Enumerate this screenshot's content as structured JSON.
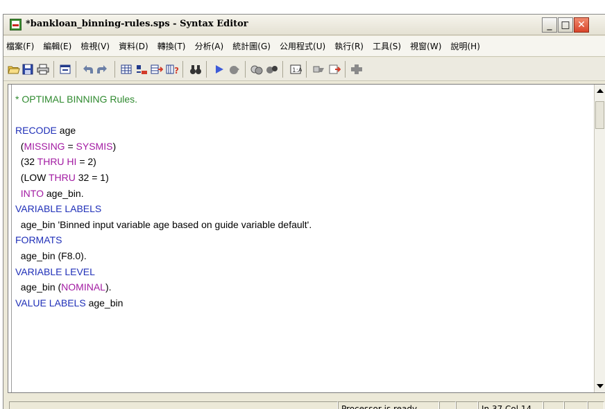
{
  "window": {
    "title": "*bankloan_binning-rules.sps - Syntax Editor",
    "minimize_symbol": "_",
    "maximize_symbol": "□",
    "close_symbol": "✕"
  },
  "menu": {
    "items": [
      {
        "label": "檔案(F)"
      },
      {
        "label": "編輯(E)"
      },
      {
        "label": "檢視(V)"
      },
      {
        "label": "資料(D)"
      },
      {
        "label": "轉換(T)"
      },
      {
        "label": "分析(A)"
      },
      {
        "label": "統計圖(G)"
      },
      {
        "label": "公用程式(U)"
      },
      {
        "label": "執行(R)"
      },
      {
        "label": "工具(S)"
      },
      {
        "label": "視窗(W)"
      },
      {
        "label": "說明(H)"
      }
    ]
  },
  "toolbar": {
    "icons": [
      "open-folder-icon",
      "save-icon",
      "print-icon",
      "dialog-recall-icon",
      "undo-icon",
      "redo-icon",
      "goto-data-icon",
      "goto-case-icon",
      "insert-variable-icon",
      "variables-info-icon",
      "find-icon",
      "run-icon",
      "stop-icon",
      "split-file-icon",
      "weight-cases-icon",
      "value-labels-icon",
      "use-sets-icon",
      "designate-window-icon",
      "add-icon"
    ]
  },
  "editor": {
    "lines": [
      [
        {
          "t": "* OPTIMAL BINNING Rules.",
          "c": "comment"
        }
      ],
      [
        {
          "t": "",
          "c": "plain"
        }
      ],
      [
        {
          "t": "RECODE",
          "c": "kw"
        },
        {
          "t": " age",
          "c": "plain"
        }
      ],
      [
        {
          "t": "  (",
          "c": "plain"
        },
        {
          "t": "MISSING",
          "c": "sub"
        },
        {
          "t": " = ",
          "c": "plain"
        },
        {
          "t": "SYSMIS",
          "c": "sub"
        },
        {
          "t": ")",
          "c": "plain"
        }
      ],
      [
        {
          "t": "  (32 ",
          "c": "plain"
        },
        {
          "t": "THRU HI",
          "c": "sub"
        },
        {
          "t": " = 2)",
          "c": "plain"
        }
      ],
      [
        {
          "t": "  (LOW ",
          "c": "plain"
        },
        {
          "t": "THRU",
          "c": "sub"
        },
        {
          "t": " 32 = 1)",
          "c": "plain"
        }
      ],
      [
        {
          "t": "  ",
          "c": "plain"
        },
        {
          "t": "INTO",
          "c": "sub"
        },
        {
          "t": " age_bin.",
          "c": "plain"
        }
      ],
      [
        {
          "t": "VARIABLE LABELS",
          "c": "kw"
        }
      ],
      [
        {
          "t": "  age_bin 'Binned input variable age based on guide variable default'.",
          "c": "plain"
        }
      ],
      [
        {
          "t": "FORMATS",
          "c": "kw"
        }
      ],
      [
        {
          "t": "  age_bin (F8.0).",
          "c": "plain"
        }
      ],
      [
        {
          "t": "VARIABLE LEVEL",
          "c": "kw"
        }
      ],
      [
        {
          "t": "  age_bin (",
          "c": "plain"
        },
        {
          "t": "NOMINAL",
          "c": "sub"
        },
        {
          "t": ").",
          "c": "plain"
        }
      ],
      [
        {
          "t": "VALUE LABELS",
          "c": "kw"
        },
        {
          "t": " age_bin",
          "c": "plain"
        }
      ]
    ]
  },
  "status": {
    "processor": "Processor is ready",
    "position": "In 37 Col 14"
  }
}
